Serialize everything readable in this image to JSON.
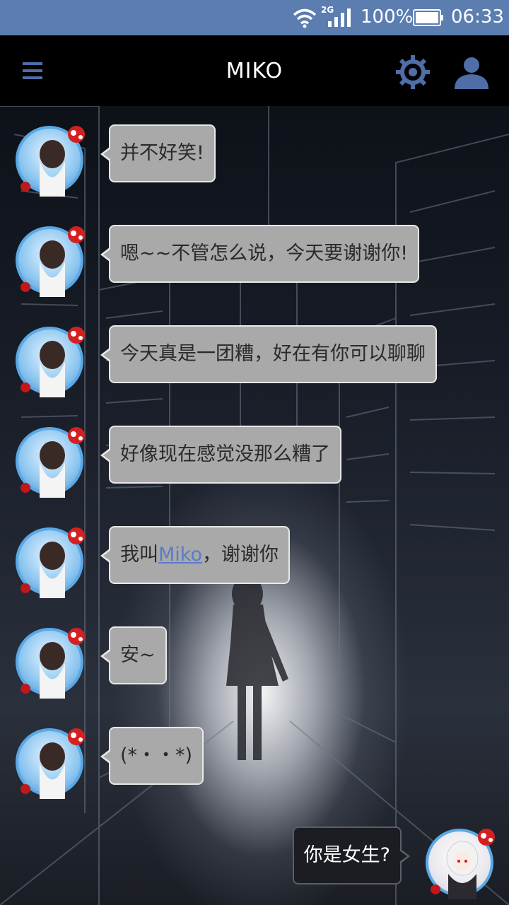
{
  "status_bar": {
    "network": "2G",
    "battery": "100%",
    "time": "06:33",
    "icons": [
      "wifi-icon",
      "signal-icon",
      "battery-icon"
    ]
  },
  "app_bar": {
    "title": "MIKO",
    "icons": [
      "menu-icon",
      "gear-icon",
      "user-icon"
    ]
  },
  "messages": [
    {
      "sender": "bot",
      "text": "并不好笑!"
    },
    {
      "sender": "bot",
      "text": "嗯~~不管怎么说，今天要谢谢你!"
    },
    {
      "sender": "bot",
      "text": "今天真是一团糟，好在有你可以聊聊"
    },
    {
      "sender": "bot",
      "text": "好像现在感觉没那么糟了"
    },
    {
      "sender": "bot",
      "text_before": "我叫",
      "link": "Miko",
      "text_after": "，谢谢你"
    },
    {
      "sender": "bot",
      "text": "安~"
    },
    {
      "sender": "bot",
      "text": "(*・・*)"
    },
    {
      "sender": "user",
      "text": "你是女生?"
    }
  ],
  "colors": {
    "status_bar": "#5b7db0",
    "app_bar": "#000000",
    "icon_accent": "#4f6ea8",
    "bot_bubble": "#a9a9a9",
    "user_bubble": "#1b1d22",
    "link": "#5b7bc8",
    "avatar_ring": "#5aa8e6"
  }
}
